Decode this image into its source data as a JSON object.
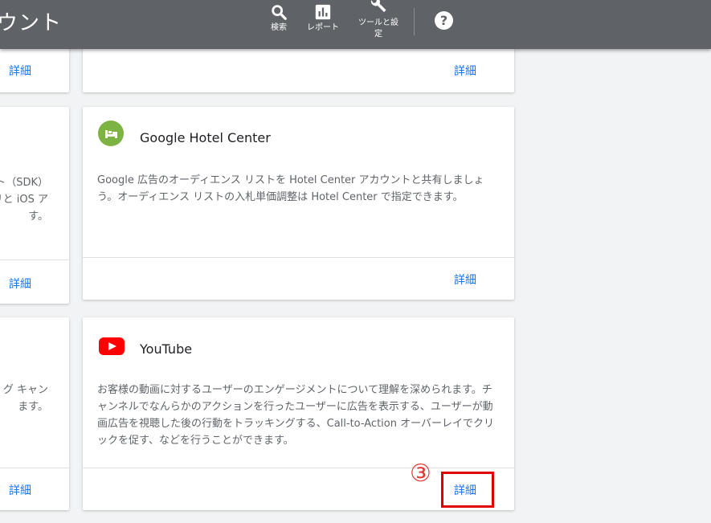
{
  "header": {
    "title": "ウント",
    "tools": [
      {
        "label": "検索",
        "icon": "search-icon"
      },
      {
        "label": "レポート",
        "icon": "bar-chart-icon"
      },
      {
        "label": "ツールと設定",
        "icon": "wrench-icon"
      }
    ],
    "help_glyph": "?"
  },
  "cards": {
    "detail_label": "詳細",
    "left_middle_desc": [
      "ト（SDK）",
      "リと iOS ア",
      "す。"
    ],
    "left_bottom_desc": [
      "グ キャン",
      "ます。"
    ],
    "hotel": {
      "title": "Google Hotel Center",
      "icon": "bed-icon",
      "description": "Google 広告のオーディエンス リストを Hotel Center アカウントと共有しましょう。オーディエンス リストの入札単価調整は Hotel Center で指定できます。"
    },
    "youtube": {
      "title": "YouTube",
      "icon": "youtube-icon",
      "description": "お客様の動画に対するユーザーのエンゲージメントについて理解を深められます。チャンネルでなんらかのアクションを行ったユーザーに広告を表示する、ユーザーが動画広告を視聴した後の行動をトラッキングする、Call-to-Action オーバーレイでクリックを促す、などを行うことができます。"
    }
  },
  "annotation": {
    "number": "③",
    "color": "#e00000"
  },
  "colors": {
    "header": "#5f6368",
    "link": "#1a73e8",
    "background": "#f1f3f4"
  }
}
